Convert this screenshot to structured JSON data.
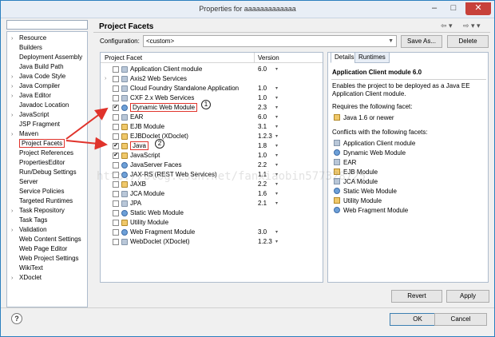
{
  "window": {
    "title": "Properties for aaaaaaaaaaaaa"
  },
  "nav": {
    "items": [
      {
        "label": "Resource",
        "arrow": "›"
      },
      {
        "label": "Builders",
        "arrow": ""
      },
      {
        "label": "Deployment Assembly",
        "arrow": ""
      },
      {
        "label": "Java Build Path",
        "arrow": ""
      },
      {
        "label": "Java Code Style",
        "arrow": "›"
      },
      {
        "label": "Java Compiler",
        "arrow": "›"
      },
      {
        "label": "Java Editor",
        "arrow": "›"
      },
      {
        "label": "Javadoc Location",
        "arrow": ""
      },
      {
        "label": "JavaScript",
        "arrow": "›"
      },
      {
        "label": "JSP Fragment",
        "arrow": ""
      },
      {
        "label": "Maven",
        "arrow": "›"
      },
      {
        "label": "Project Facets",
        "arrow": ""
      },
      {
        "label": "Project References",
        "arrow": ""
      },
      {
        "label": "PropertiesEditor",
        "arrow": ""
      },
      {
        "label": "Run/Debug Settings",
        "arrow": ""
      },
      {
        "label": "Server",
        "arrow": ""
      },
      {
        "label": "Service Policies",
        "arrow": ""
      },
      {
        "label": "Targeted Runtimes",
        "arrow": ""
      },
      {
        "label": "Task Repository",
        "arrow": "›"
      },
      {
        "label": "Task Tags",
        "arrow": ""
      },
      {
        "label": "Validation",
        "arrow": "›"
      },
      {
        "label": "Web Content Settings",
        "arrow": ""
      },
      {
        "label": "Web Page Editor",
        "arrow": ""
      },
      {
        "label": "Web Project Settings",
        "arrow": ""
      },
      {
        "label": "WikiText",
        "arrow": ""
      },
      {
        "label": "XDoclet",
        "arrow": "›"
      }
    ],
    "selected": "Project Facets"
  },
  "page": {
    "title": "Project Facets"
  },
  "config": {
    "label": "Configuration:",
    "value": "<custom>",
    "save_as": "Save As...",
    "delete": "Delete"
  },
  "facets": {
    "col_facet": "Project Facet",
    "col_version": "Version",
    "rows": [
      {
        "label": "Application Client module",
        "version": "6.0",
        "checked": false,
        "expand": ""
      },
      {
        "label": "Axis2 Web Services",
        "version": "",
        "checked": false,
        "expand": "›"
      },
      {
        "label": "Cloud Foundry Standalone Application",
        "version": "1.0",
        "checked": false,
        "expand": ""
      },
      {
        "label": "CXF 2.x Web Services",
        "version": "1.0",
        "checked": false,
        "expand": ""
      },
      {
        "label": "Dynamic Web Module",
        "version": "2.3",
        "checked": true,
        "expand": ""
      },
      {
        "label": "EAR",
        "version": "6.0",
        "checked": false,
        "expand": ""
      },
      {
        "label": "EJB Module",
        "version": "3.1",
        "checked": false,
        "expand": ""
      },
      {
        "label": "EJBDoclet (XDoclet)",
        "version": "1.2.3",
        "checked": false,
        "expand": ""
      },
      {
        "label": "Java",
        "version": "1.8",
        "checked": true,
        "expand": ""
      },
      {
        "label": "JavaScript",
        "version": "1.0",
        "checked": true,
        "expand": ""
      },
      {
        "label": "JavaServer Faces",
        "version": "2.2",
        "checked": false,
        "expand": ""
      },
      {
        "label": "JAX-RS (REST Web Services)",
        "version": "1.1",
        "checked": false,
        "expand": ""
      },
      {
        "label": "JAXB",
        "version": "2.2",
        "checked": false,
        "expand": ""
      },
      {
        "label": "JCA Module",
        "version": "1.6",
        "checked": false,
        "expand": ""
      },
      {
        "label": "JPA",
        "version": "2.1",
        "checked": false,
        "expand": ""
      },
      {
        "label": "Static Web Module",
        "version": "",
        "checked": false,
        "expand": ""
      },
      {
        "label": "Utility Module",
        "version": "",
        "checked": false,
        "expand": ""
      },
      {
        "label": "Web Fragment Module",
        "version": "3.0",
        "checked": false,
        "expand": ""
      },
      {
        "label": "WebDoclet (XDoclet)",
        "version": "1.2.3",
        "checked": false,
        "expand": ""
      }
    ]
  },
  "details": {
    "tab_details": "Details",
    "tab_runtimes": "Runtimes",
    "title": "Application Client module 6.0",
    "desc1": "Enables the project to be deployed as a Java EE",
    "desc2": "Application Client module.",
    "requires_label": "Requires the following facet:",
    "requires": [
      "Java 1.6 or newer"
    ],
    "conflicts_label": "Conflicts with the following facets:",
    "conflicts": [
      "Application Client module",
      "Dynamic Web Module",
      "EAR",
      "EJB Module",
      "JCA Module",
      "Static Web Module",
      "Utility Module",
      "Web Fragment Module"
    ]
  },
  "buttons": {
    "revert": "Revert",
    "apply": "Apply",
    "ok": "OK",
    "cancel": "Cancel",
    "help": "?"
  },
  "annotations": {
    "one": "1",
    "two": "2"
  },
  "watermark": "http://blog.csdn.net/fanxiaobin577328725",
  "colors": {
    "highlight_red": "#e0332b",
    "title_bar": "#e8eef6"
  }
}
